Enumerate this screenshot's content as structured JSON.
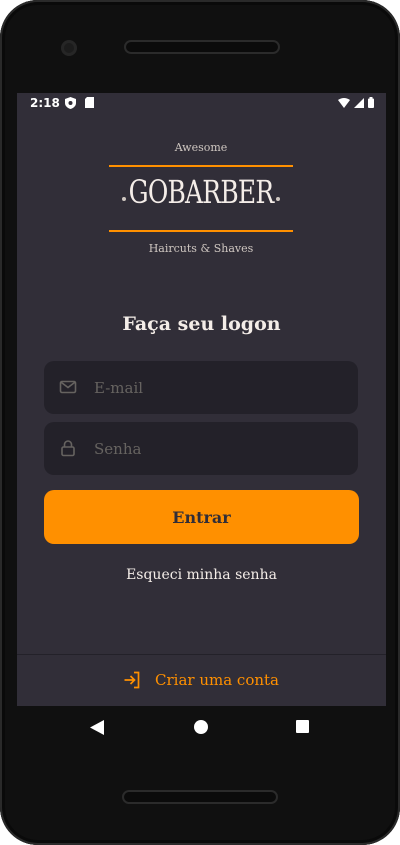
{
  "status": {
    "time": "2:18"
  },
  "logo": {
    "top_text": "Awesome",
    "brand": "GOBARBER",
    "tagline": "Haircuts & Shaves",
    "accent_color": "#ff9000"
  },
  "form": {
    "title": "Faça seu logon",
    "email_placeholder": "E-mail",
    "email_value": "",
    "password_placeholder": "Senha",
    "password_value": "",
    "submit_label": "Entrar",
    "forgot_label": "Esqueci minha senha"
  },
  "footer": {
    "create_account_label": "Criar uma conta"
  },
  "icons": {
    "email": "mail-icon",
    "password": "lock-icon",
    "create_account": "log-in-icon",
    "nav_back": "back-triangle-icon",
    "nav_home": "home-circle-icon",
    "nav_recent": "recent-apps-square-icon"
  },
  "colors": {
    "background": "#312e38",
    "input_background": "#232129",
    "placeholder": "#666360",
    "text": "#f4ede8",
    "accent": "#ff9000"
  }
}
